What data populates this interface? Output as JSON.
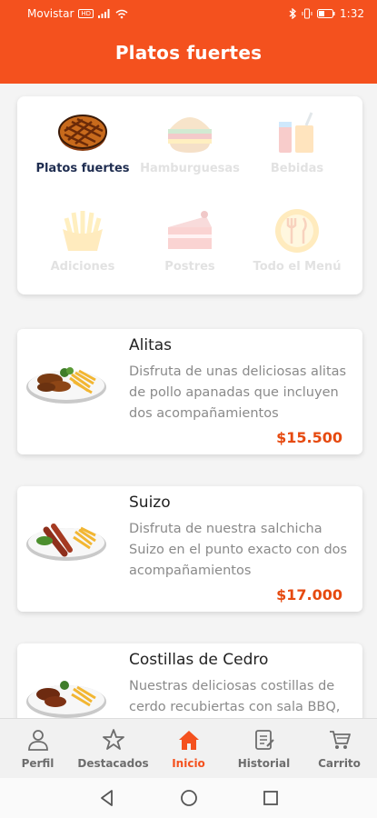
{
  "status_bar": {
    "carrier": "Movistar",
    "carrier_badge": "HD",
    "time": "1:32"
  },
  "header": {
    "title": "Platos fuertes"
  },
  "categories": [
    {
      "label": "Platos fuertes",
      "icon": "steak-icon",
      "active": true
    },
    {
      "label": "Hamburguesas",
      "icon": "burger-icon",
      "active": false
    },
    {
      "label": "Bebidas",
      "icon": "drinks-icon",
      "active": false
    },
    {
      "label": "Adiciones",
      "icon": "fries-icon",
      "active": false
    },
    {
      "label": "Postres",
      "icon": "cake-icon",
      "active": false
    },
    {
      "label": "Todo el Menú",
      "icon": "cutlery-icon",
      "active": false
    }
  ],
  "products": [
    {
      "name": "Alitas",
      "description": "Disfruta de unas deliciosas alitas de pollo apanadas que incluyen dos acompañamientos",
      "price": "$15.500"
    },
    {
      "name": "Suizo",
      "description": "Disfruta de nuestra salchicha Suizo en el punto exacto con dos acompañamientos",
      "price": "$17.000"
    },
    {
      "name": "Costillas de Cedro",
      "description": "Nuestras deliciosas costillas de cerdo recubiertas con sala BBQ,",
      "price": ""
    }
  ],
  "bottom_nav": [
    {
      "label": "Perfil",
      "icon": "user-icon",
      "active": false
    },
    {
      "label": "Destacados",
      "icon": "star-icon",
      "active": false
    },
    {
      "label": "Inicio",
      "icon": "home-icon",
      "active": true
    },
    {
      "label": "Historial",
      "icon": "history-icon",
      "active": false
    },
    {
      "label": "Carrito",
      "icon": "cart-icon",
      "active": false
    }
  ],
  "colors": {
    "brand": "#f4511e",
    "price": "#e64a10",
    "active_category": "#1f2d50"
  }
}
